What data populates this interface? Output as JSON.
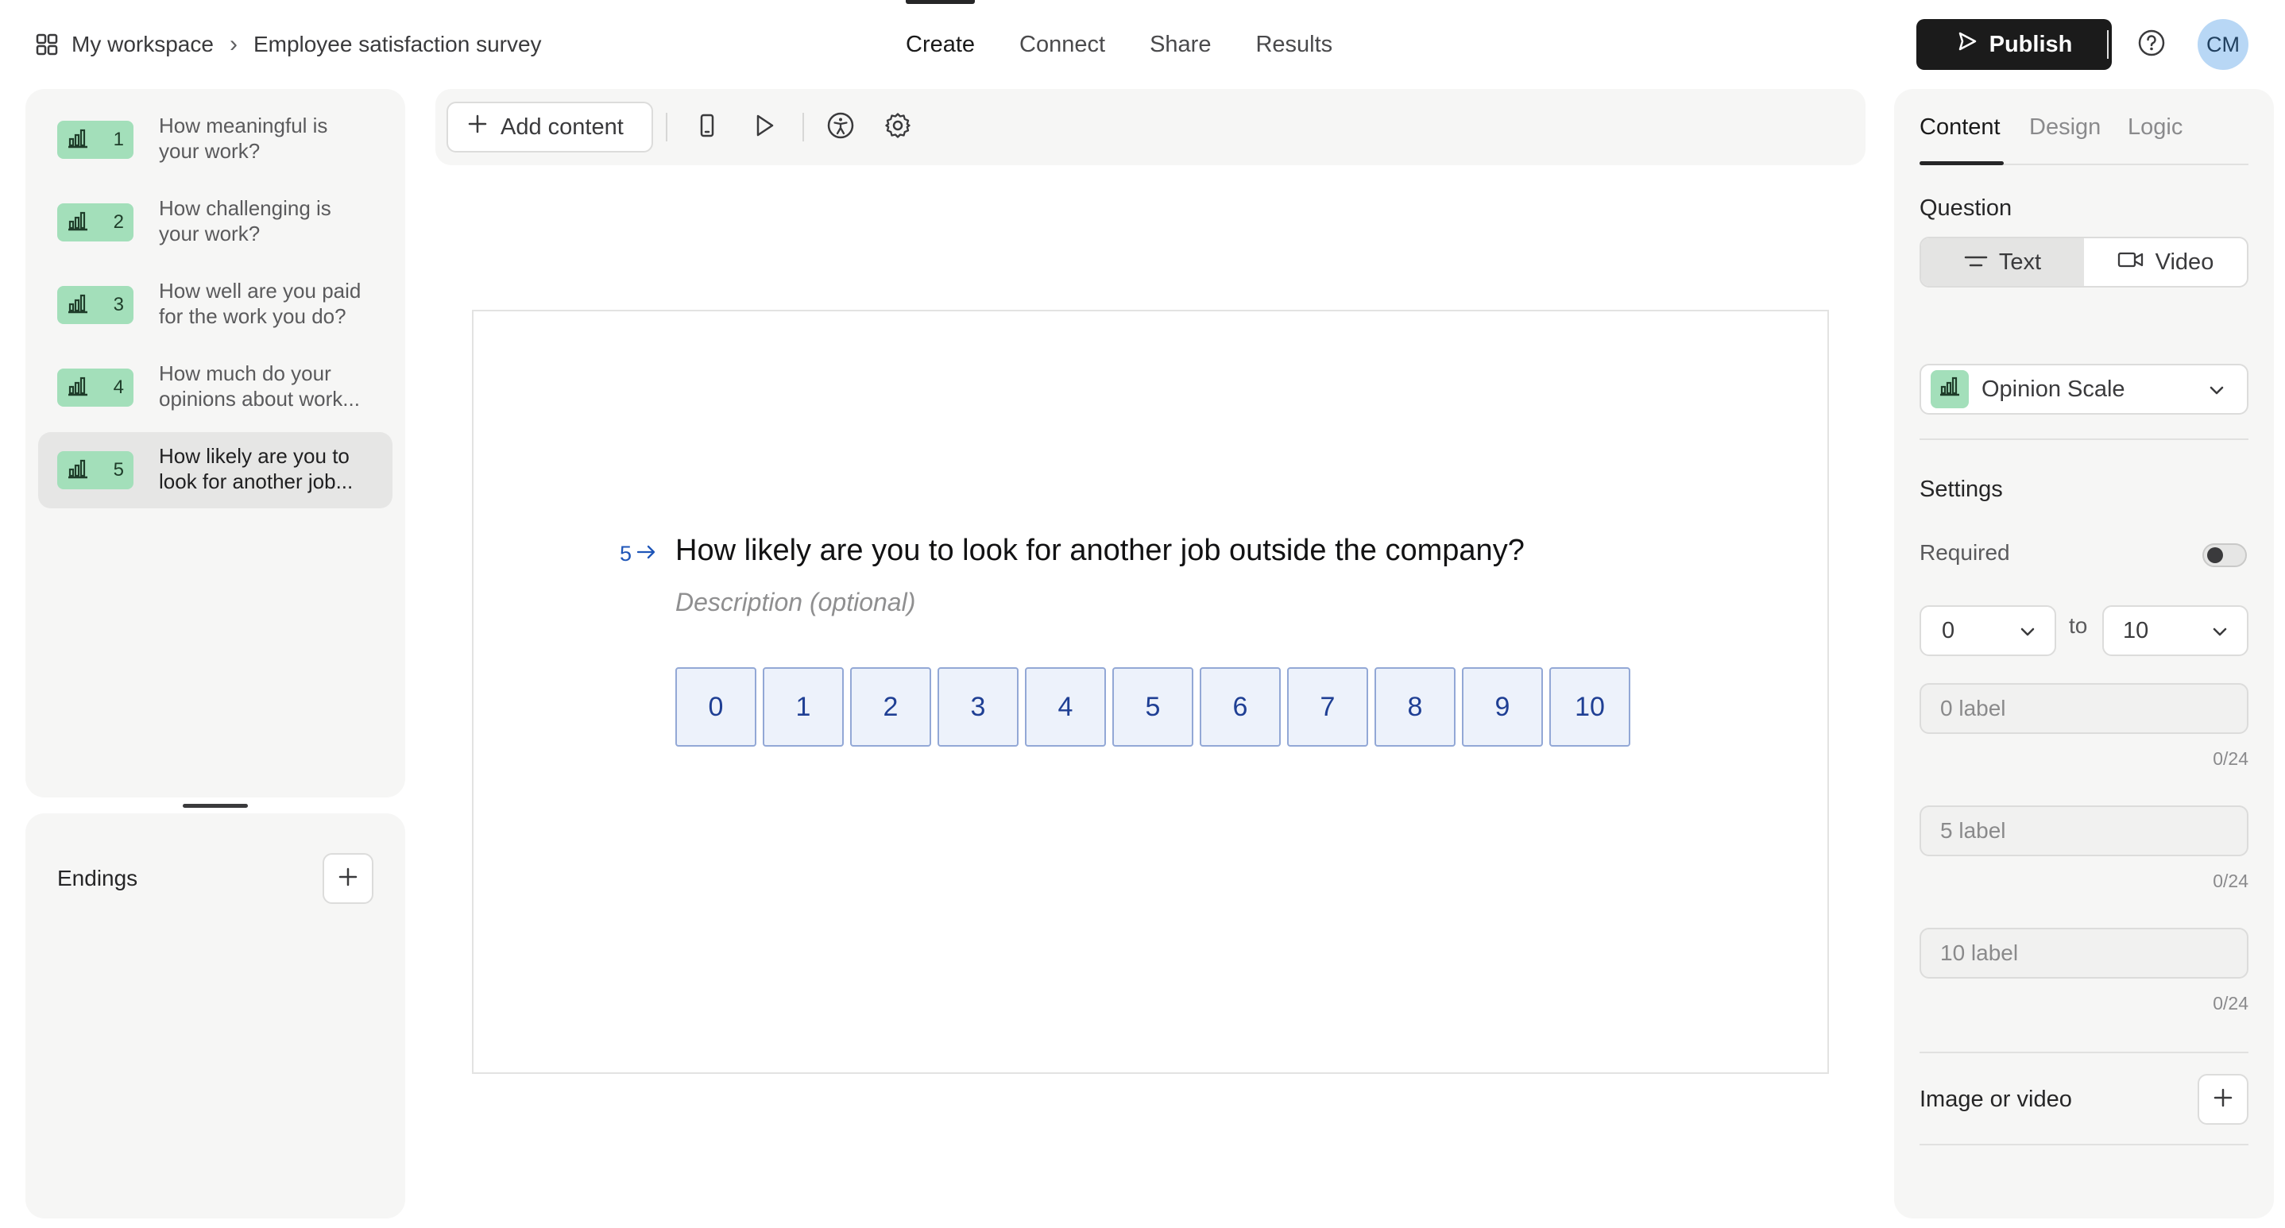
{
  "breadcrumb": {
    "workspace": "My workspace",
    "separator": "›",
    "form": "Employee satisfaction survey"
  },
  "nav": {
    "create": "Create",
    "connect": "Connect",
    "share": "Share",
    "results": "Results"
  },
  "header": {
    "publish_label": "Publish",
    "avatar_initials": "CM"
  },
  "sidebar": {
    "questions": [
      {
        "number": "1",
        "line1": "How meaningful is",
        "line2": "your work?"
      },
      {
        "number": "2",
        "line1": "How challenging is",
        "line2": "your work?"
      },
      {
        "number": "3",
        "line1": "How well are you paid",
        "line2": "for the work you do?"
      },
      {
        "number": "4",
        "line1": "How much do your",
        "line2": "opinions about work..."
      },
      {
        "number": "5",
        "line1": "How likely are you to",
        "line2": "look for another job..."
      }
    ],
    "endings_label": "Endings"
  },
  "toolbar": {
    "add_content_label": "Add content"
  },
  "canvas": {
    "question_number": "5",
    "question_title": "How likely are you to look for another job outside the company?",
    "description_placeholder": "Description (optional)",
    "scale": [
      "0",
      "1",
      "2",
      "3",
      "4",
      "5",
      "6",
      "7",
      "8",
      "9",
      "10"
    ]
  },
  "settings": {
    "tabs": {
      "content": "Content",
      "design": "Design",
      "logic": "Logic"
    },
    "question_label": "Question",
    "segment": {
      "text": "Text",
      "video": "Video"
    },
    "question_type": "Opinion Scale",
    "settings_label": "Settings",
    "required_label": "Required",
    "range": {
      "from": "0",
      "to_label": "to",
      "to": "10"
    },
    "labels": [
      {
        "placeholder": "0 label",
        "counter": "0/24"
      },
      {
        "placeholder": "5 label",
        "counter": "0/24"
      },
      {
        "placeholder": "10 label",
        "counter": "0/24"
      }
    ],
    "media_label": "Image or video"
  },
  "colors": {
    "accent": "#1f56b8",
    "badge": "#a3dfba",
    "publish": "#1b1b1b",
    "scale_fill": "#edf2fb",
    "scale_border": "#93a8d6"
  }
}
